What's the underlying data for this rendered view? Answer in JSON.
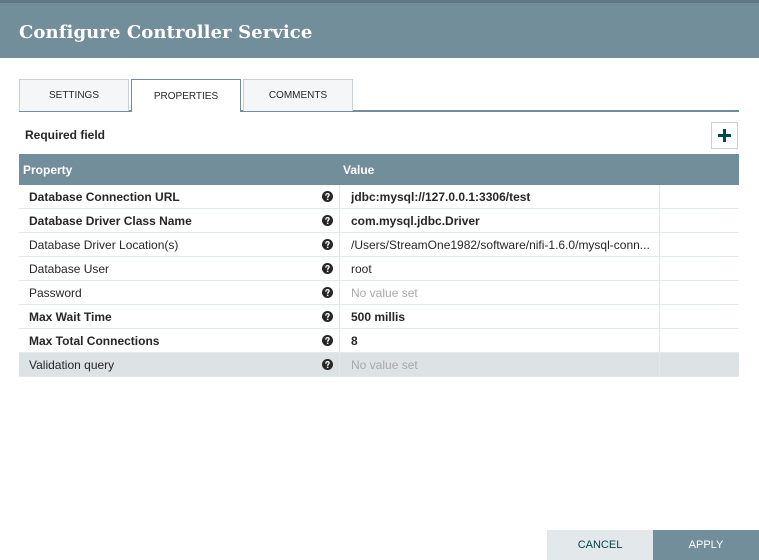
{
  "dialog": {
    "title": "Configure Controller Service"
  },
  "tabs": [
    {
      "label": "SETTINGS",
      "active": false
    },
    {
      "label": "PROPERTIES",
      "active": true
    },
    {
      "label": "COMMENTS",
      "active": false
    }
  ],
  "required_label": "Required field",
  "add_icon": "plus-icon",
  "table": {
    "headers": {
      "property": "Property",
      "value": "Value"
    },
    "rows": [
      {
        "name": "Database Connection URL",
        "value": "jdbc:mysql://127.0.0.1:3306/test",
        "required": true,
        "empty": false
      },
      {
        "name": "Database Driver Class Name",
        "value": "com.mysql.jdbc.Driver",
        "required": true,
        "empty": false
      },
      {
        "name": "Database Driver Location(s)",
        "value": "/Users/StreamOne1982/software/nifi-1.6.0/mysql-conn...",
        "required": false,
        "empty": false
      },
      {
        "name": "Database User",
        "value": "root",
        "required": false,
        "empty": false
      },
      {
        "name": "Password",
        "value": "No value set",
        "required": false,
        "empty": true
      },
      {
        "name": "Max Wait Time",
        "value": "500 millis",
        "required": true,
        "empty": false
      },
      {
        "name": "Max Total Connections",
        "value": "8",
        "required": true,
        "empty": false
      },
      {
        "name": "Validation query",
        "value": "No value set",
        "required": false,
        "empty": true
      }
    ]
  },
  "buttons": {
    "cancel": "CANCEL",
    "apply": "APPLY"
  },
  "colors": {
    "header": "#728e9b",
    "accent": "#004849"
  }
}
